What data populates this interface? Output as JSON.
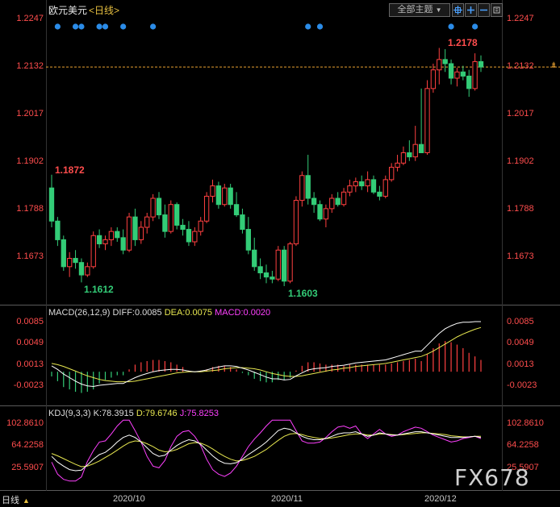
{
  "header": {
    "pair": "欧元美元",
    "period_open": "<",
    "period": "日线",
    "period_close": ">"
  },
  "toolbar": {
    "main_indicator": "全部主题",
    "drop_icon": "▼"
  },
  "price_axis": {
    "labels": [
      "1.2247",
      "1.2132",
      "1.2017",
      "1.1902",
      "1.1788",
      "1.1673"
    ]
  },
  "annotations": {
    "high_right": "1.2178",
    "high_left": "1.1872",
    "low_left": "1.1612",
    "low_mid": "1.1603"
  },
  "current_price": "1.2132",
  "macd": {
    "label": "MACD(26,12,9)",
    "diff": "DIFF:0.0085",
    "dea": "DEA:0.0075",
    "macd": "MACD:0.0020",
    "axis": [
      "0.0085",
      "0.0049",
      "0.0013",
      "-0.0023"
    ]
  },
  "kdj": {
    "label": "KDJ(9,3,3)",
    "k": "K:78.3915",
    "d": "D:79.6746",
    "j": "J:75.8253",
    "axis_left": [
      "102.8610",
      "64.2258",
      "25.5907"
    ],
    "axis_right": [
      "102.8610",
      "64.2258",
      "25.5907"
    ]
  },
  "dates": [
    "2020/10",
    "2020/11",
    "2020/12"
  ],
  "footer": {
    "period_button": "日线",
    "watermark": "FX678"
  },
  "colors": {
    "up": "#ff4040",
    "down": "#33cc77",
    "dot": "#2b8ce8",
    "macd_diff": "#ffffff",
    "macd_dea": "#e8e850",
    "kdj_j": "#ff40ff"
  },
  "chart_data": {
    "type": "candlestick",
    "title": "欧元美元",
    "ylim": [
      1.155,
      1.228
    ],
    "candles": [
      {
        "o": 1.184,
        "h": 1.1872,
        "l": 1.1745,
        "c": 1.176
      },
      {
        "o": 1.176,
        "h": 1.177,
        "l": 1.17,
        "c": 1.1715
      },
      {
        "o": 1.1715,
        "h": 1.1725,
        "l": 1.164,
        "c": 1.165
      },
      {
        "o": 1.165,
        "h": 1.1685,
        "l": 1.1625,
        "c": 1.167
      },
      {
        "o": 1.167,
        "h": 1.169,
        "l": 1.1645,
        "c": 1.166
      },
      {
        "o": 1.166,
        "h": 1.167,
        "l": 1.1612,
        "c": 1.163
      },
      {
        "o": 1.163,
        "h": 1.166,
        "l": 1.1625,
        "c": 1.165
      },
      {
        "o": 1.165,
        "h": 1.1735,
        "l": 1.1645,
        "c": 1.1725
      },
      {
        "o": 1.1725,
        "h": 1.174,
        "l": 1.1695,
        "c": 1.1705
      },
      {
        "o": 1.1705,
        "h": 1.1725,
        "l": 1.169,
        "c": 1.1715
      },
      {
        "o": 1.1715,
        "h": 1.1745,
        "l": 1.17,
        "c": 1.1735
      },
      {
        "o": 1.1735,
        "h": 1.1745,
        "l": 1.171,
        "c": 1.172
      },
      {
        "o": 1.172,
        "h": 1.174,
        "l": 1.168,
        "c": 1.169
      },
      {
        "o": 1.169,
        "h": 1.178,
        "l": 1.1685,
        "c": 1.177
      },
      {
        "o": 1.177,
        "h": 1.179,
        "l": 1.17,
        "c": 1.1715
      },
      {
        "o": 1.1715,
        "h": 1.176,
        "l": 1.1705,
        "c": 1.1745
      },
      {
        "o": 1.1745,
        "h": 1.178,
        "l": 1.173,
        "c": 1.177
      },
      {
        "o": 1.177,
        "h": 1.1825,
        "l": 1.176,
        "c": 1.1815
      },
      {
        "o": 1.1815,
        "h": 1.183,
        "l": 1.1765,
        "c": 1.1775
      },
      {
        "o": 1.1775,
        "h": 1.18,
        "l": 1.172,
        "c": 1.1735
      },
      {
        "o": 1.1735,
        "h": 1.181,
        "l": 1.173,
        "c": 1.18
      },
      {
        "o": 1.18,
        "h": 1.1805,
        "l": 1.174,
        "c": 1.175
      },
      {
        "o": 1.175,
        "h": 1.1765,
        "l": 1.1725,
        "c": 1.174
      },
      {
        "o": 1.174,
        "h": 1.176,
        "l": 1.17,
        "c": 1.171
      },
      {
        "o": 1.171,
        "h": 1.1745,
        "l": 1.17,
        "c": 1.1735
      },
      {
        "o": 1.1735,
        "h": 1.177,
        "l": 1.1725,
        "c": 1.176
      },
      {
        "o": 1.176,
        "h": 1.183,
        "l": 1.1755,
        "c": 1.182
      },
      {
        "o": 1.182,
        "h": 1.186,
        "l": 1.1805,
        "c": 1.1845
      },
      {
        "o": 1.1845,
        "h": 1.1855,
        "l": 1.179,
        "c": 1.18
      },
      {
        "o": 1.18,
        "h": 1.185,
        "l": 1.1795,
        "c": 1.184
      },
      {
        "o": 1.184,
        "h": 1.185,
        "l": 1.179,
        "c": 1.18
      },
      {
        "o": 1.18,
        "h": 1.183,
        "l": 1.177,
        "c": 1.1775
      },
      {
        "o": 1.1775,
        "h": 1.179,
        "l": 1.173,
        "c": 1.174
      },
      {
        "o": 1.174,
        "h": 1.177,
        "l": 1.168,
        "c": 1.169
      },
      {
        "o": 1.169,
        "h": 1.172,
        "l": 1.164,
        "c": 1.165
      },
      {
        "o": 1.165,
        "h": 1.167,
        "l": 1.162,
        "c": 1.1635
      },
      {
        "o": 1.1635,
        "h": 1.1655,
        "l": 1.161,
        "c": 1.1625
      },
      {
        "o": 1.1625,
        "h": 1.164,
        "l": 1.161,
        "c": 1.162
      },
      {
        "o": 1.162,
        "h": 1.17,
        "l": 1.1615,
        "c": 1.169
      },
      {
        "o": 1.169,
        "h": 1.17,
        "l": 1.1603,
        "c": 1.1615
      },
      {
        "o": 1.1615,
        "h": 1.171,
        "l": 1.161,
        "c": 1.1705
      },
      {
        "o": 1.1705,
        "h": 1.182,
        "l": 1.17,
        "c": 1.181
      },
      {
        "o": 1.181,
        "h": 1.188,
        "l": 1.1795,
        "c": 1.187
      },
      {
        "o": 1.187,
        "h": 1.192,
        "l": 1.18,
        "c": 1.1815
      },
      {
        "o": 1.1815,
        "h": 1.183,
        "l": 1.178,
        "c": 1.18
      },
      {
        "o": 1.18,
        "h": 1.181,
        "l": 1.176,
        "c": 1.1765
      },
      {
        "o": 1.1765,
        "h": 1.18,
        "l": 1.1745,
        "c": 1.179
      },
      {
        "o": 1.179,
        "h": 1.1825,
        "l": 1.178,
        "c": 1.1815
      },
      {
        "o": 1.1815,
        "h": 1.183,
        "l": 1.1795,
        "c": 1.18
      },
      {
        "o": 1.18,
        "h": 1.184,
        "l": 1.1795,
        "c": 1.183
      },
      {
        "o": 1.183,
        "h": 1.186,
        "l": 1.182,
        "c": 1.1845
      },
      {
        "o": 1.1845,
        "h": 1.1865,
        "l": 1.183,
        "c": 1.1855
      },
      {
        "o": 1.1855,
        "h": 1.187,
        "l": 1.1835,
        "c": 1.1845
      },
      {
        "o": 1.1845,
        "h": 1.188,
        "l": 1.183,
        "c": 1.186
      },
      {
        "o": 1.186,
        "h": 1.187,
        "l": 1.1825,
        "c": 1.183
      },
      {
        "o": 1.183,
        "h": 1.1845,
        "l": 1.181,
        "c": 1.182
      },
      {
        "o": 1.182,
        "h": 1.187,
        "l": 1.1815,
        "c": 1.186
      },
      {
        "o": 1.186,
        "h": 1.19,
        "l": 1.1855,
        "c": 1.189
      },
      {
        "o": 1.189,
        "h": 1.192,
        "l": 1.188,
        "c": 1.19
      },
      {
        "o": 1.19,
        "h": 1.194,
        "l": 1.1895,
        "c": 1.1925
      },
      {
        "o": 1.1925,
        "h": 1.1955,
        "l": 1.1905,
        "c": 1.1915
      },
      {
        "o": 1.1915,
        "h": 1.199,
        "l": 1.1905,
        "c": 1.1945
      },
      {
        "o": 1.1945,
        "h": 1.208,
        "l": 1.194,
        "c": 1.1925
      },
      {
        "o": 1.1925,
        "h": 1.21,
        "l": 1.192,
        "c": 1.208
      },
      {
        "o": 1.208,
        "h": 1.214,
        "l": 1.207,
        "c": 1.2125
      },
      {
        "o": 1.2125,
        "h": 1.2178,
        "l": 1.209,
        "c": 1.215
      },
      {
        "o": 1.215,
        "h": 1.2175,
        "l": 1.212,
        "c": 1.214
      },
      {
        "o": 1.214,
        "h": 1.215,
        "l": 1.209,
        "c": 1.2105
      },
      {
        "o": 1.2105,
        "h": 1.213,
        "l": 1.2085,
        "c": 1.212
      },
      {
        "o": 1.212,
        "h": 1.2135,
        "l": 1.21,
        "c": 1.211
      },
      {
        "o": 1.211,
        "h": 1.2125,
        "l": 1.206,
        "c": 1.208
      },
      {
        "o": 1.208,
        "h": 1.2165,
        "l": 1.2075,
        "c": 1.2145
      },
      {
        "o": 1.2145,
        "h": 1.216,
        "l": 1.212,
        "c": 1.2132
      }
    ],
    "dot_indices": [
      1,
      4,
      5,
      8,
      9,
      12,
      17,
      43,
      45,
      67,
      71
    ],
    "macd": {
      "ylim": [
        -0.0045,
        0.0095
      ],
      "diff": [
        0.001,
        0.0004,
        -0.0004,
        -0.001,
        -0.0016,
        -0.0021,
        -0.0024,
        -0.0025,
        -0.0023,
        -0.0022,
        -0.0021,
        -0.002,
        -0.002,
        -0.0015,
        -0.001,
        -0.0006,
        -0.0003,
        0.0,
        0.0002,
        0.0003,
        0.0004,
        0.0004,
        0.0003,
        0.0001,
        0.0,
        0.0001,
        0.0003,
        0.0006,
        0.0008,
        0.001,
        0.001,
        0.0009,
        0.0006,
        0.0003,
        -0.0001,
        -0.0005,
        -0.0009,
        -0.0012,
        -0.0012,
        -0.0014,
        -0.0013,
        -0.0007,
        -0.0002,
        0.0003,
        0.0005,
        0.0006,
        0.0007,
        0.0009,
        0.001,
        0.0011,
        0.0013,
        0.0015,
        0.0016,
        0.0017,
        0.0018,
        0.0019,
        0.002,
        0.0023,
        0.0026,
        0.0029,
        0.0032,
        0.0035,
        0.0035,
        0.0045,
        0.0055,
        0.0065,
        0.0073,
        0.0078,
        0.0082,
        0.0084,
        0.0084,
        0.0085,
        0.0085
      ],
      "dea": [
        0.0014,
        0.0012,
        0.0009,
        0.0005,
        0.0001,
        -0.0003,
        -0.0007,
        -0.001,
        -0.0013,
        -0.0015,
        -0.0016,
        -0.0017,
        -0.0017,
        -0.0017,
        -0.0016,
        -0.0014,
        -0.0012,
        -0.001,
        -0.0008,
        -0.0006,
        -0.0004,
        -0.0002,
        -0.0001,
        0.0,
        0.0,
        0.0,
        0.0001,
        0.0002,
        0.0003,
        0.0005,
        0.0006,
        0.0007,
        0.0007,
        0.0006,
        0.0005,
        0.0003,
        0.0,
        -0.0003,
        -0.0005,
        -0.0007,
        -0.0008,
        -0.0008,
        -0.0007,
        -0.0005,
        -0.0003,
        -0.0001,
        0.0001,
        0.0003,
        0.0004,
        0.0006,
        0.0007,
        0.0009,
        0.001,
        0.0011,
        0.0012,
        0.0013,
        0.0014,
        0.0016,
        0.0018,
        0.002,
        0.0022,
        0.0024,
        0.0026,
        0.003,
        0.0035,
        0.0041,
        0.0047,
        0.0053,
        0.0059,
        0.0064,
        0.0068,
        0.0072,
        0.0075
      ]
    },
    "kdj": {
      "ylim": [
        5,
        112
      ],
      "k": [
        45,
        35,
        28,
        22,
        20,
        21,
        30,
        40,
        48,
        52,
        60,
        70,
        78,
        82,
        78,
        70,
        60,
        50,
        45,
        47,
        56,
        64,
        70,
        74,
        72,
        66,
        56,
        46,
        38,
        33,
        32,
        34,
        40,
        48,
        55,
        62,
        70,
        80,
        90,
        94,
        92,
        86,
        80,
        76,
        74,
        74,
        76,
        80,
        84,
        86,
        86,
        88,
        84,
        80,
        82,
        86,
        84,
        82,
        82,
        84,
        86,
        88,
        88,
        86,
        84,
        82,
        80,
        78,
        78,
        78,
        79,
        80,
        78
      ],
      "d": [
        50,
        46,
        41,
        36,
        31,
        27,
        28,
        32,
        37,
        43,
        49,
        56,
        63,
        69,
        72,
        71,
        67,
        62,
        56,
        53,
        54,
        57,
        62,
        67,
        69,
        68,
        64,
        58,
        51,
        45,
        40,
        37,
        38,
        41,
        45,
        51,
        57,
        65,
        73,
        80,
        84,
        85,
        83,
        80,
        78,
        76,
        76,
        77,
        79,
        81,
        83,
        84,
        84,
        82,
        82,
        84,
        84,
        83,
        82,
        83,
        84,
        85,
        86,
        86,
        85,
        84,
        83,
        81,
        80,
        79,
        79,
        80,
        80
      ],
      "j": [
        35,
        14,
        5,
        2,
        2,
        9,
        36,
        55,
        70,
        72,
        84,
        98,
        108,
        108,
        90,
        70,
        45,
        28,
        25,
        38,
        62,
        80,
        88,
        90,
        80,
        64,
        40,
        22,
        14,
        10,
        16,
        28,
        45,
        62,
        75,
        86,
        98,
        108,
        108,
        108,
        108,
        90,
        72,
        68,
        68,
        70,
        78,
        88,
        96,
        98,
        94,
        98,
        84,
        76,
        84,
        92,
        84,
        80,
        82,
        88,
        92,
        96,
        94,
        88,
        82,
        78,
        74,
        70,
        72,
        76,
        78,
        80,
        76
      ]
    }
  }
}
